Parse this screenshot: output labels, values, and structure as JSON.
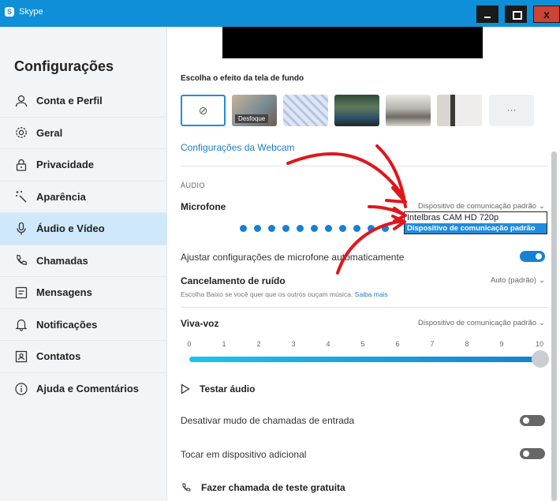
{
  "window": {
    "title": "Skype",
    "app_icon_letter": "S",
    "close_glyph": "x"
  },
  "sidebar": {
    "heading": "Configurações",
    "items": [
      {
        "label": "Conta e Perfil",
        "icon": "person-icon",
        "active": false
      },
      {
        "label": "Geral",
        "icon": "gear-icon",
        "active": false
      },
      {
        "label": "Privacidade",
        "icon": "lock-icon",
        "active": false
      },
      {
        "label": "Aparência",
        "icon": "magic-wand-icon",
        "active": false
      },
      {
        "label": "Áudio e Vídeo",
        "icon": "microphone-icon",
        "active": true
      },
      {
        "label": "Chamadas",
        "icon": "phone-icon",
        "active": false
      },
      {
        "label": "Mensagens",
        "icon": "message-icon",
        "active": false
      },
      {
        "label": "Notificações",
        "icon": "bell-icon",
        "active": false
      },
      {
        "label": "Contatos",
        "icon": "contact-card-icon",
        "active": false
      },
      {
        "label": "Ajuda e Comentários",
        "icon": "info-icon",
        "active": false
      }
    ]
  },
  "video": {
    "background_title": "Escolha o efeito da tela de fundo",
    "none_glyph": "⊘",
    "blur_label": "Desfoque",
    "more_glyph": "···",
    "webcam_link": "Configurações da Webcam"
  },
  "audio": {
    "section": "ÁUDIO",
    "microphone_label": "Microfone",
    "microphone_device": "Dispositivo de comunicação padrão",
    "microphone_options": [
      "Intelbras CAM HD 720p",
      "Dispositivo de comunicação padrão"
    ],
    "auto_adjust_label": "Ajustar configurações de microfone automaticamente",
    "auto_adjust_on": true,
    "noise_label": "Cancelamento de ruído",
    "noise_value": "Auto (padrão)",
    "noise_hint": "Escolha Baixo se você quer que os outros ouçam música.",
    "noise_link": "Saiba mais",
    "speaker_label": "Viva-voz",
    "speaker_device": "Dispositivo de comunicação padrão",
    "speaker_scale": [
      "0",
      "1",
      "2",
      "3",
      "4",
      "5",
      "6",
      "7",
      "8",
      "9",
      "10"
    ],
    "speaker_volume": 10,
    "test_audio_label": "Testar áudio",
    "mute_incoming_label": "Desativar mudo de chamadas de entrada",
    "mute_incoming_on": false,
    "extra_device_label": "Tocar em dispositivo adicional",
    "extra_device_on": false,
    "free_test_call_label": "Fazer chamada de teste gratuita"
  },
  "colors": {
    "accent": "#1580d4",
    "titlebar": "#0f8fd8",
    "annotation_arrow": "#e0161c"
  }
}
